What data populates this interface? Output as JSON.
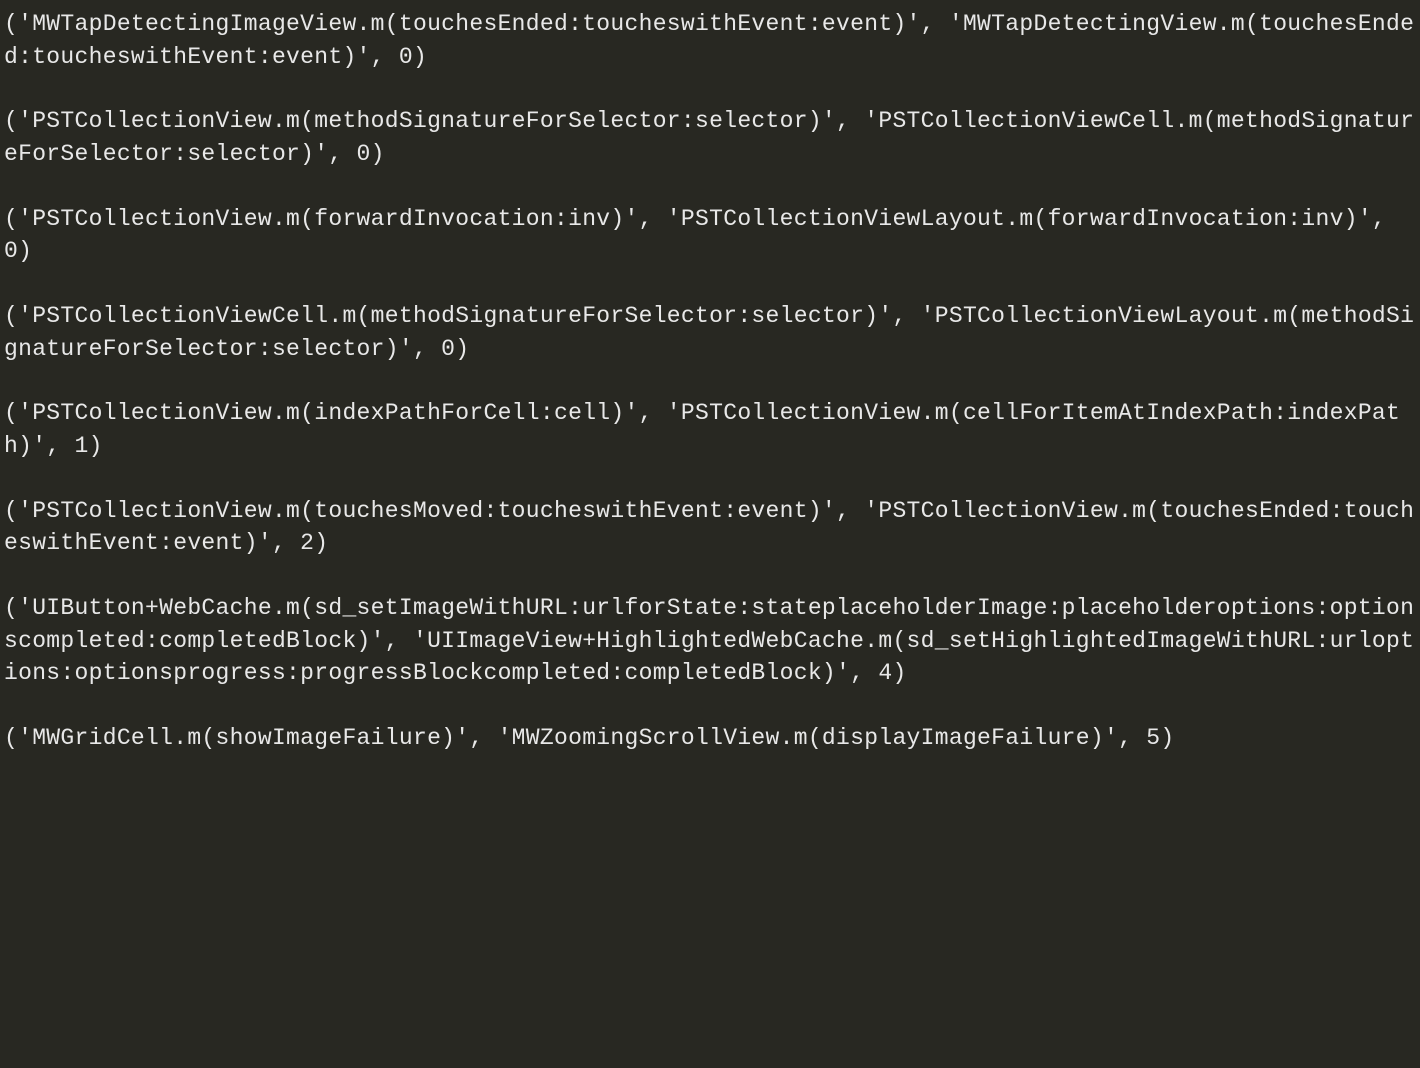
{
  "tuples": [
    "('MWTapDetectingImageView.m(touchesEnded:toucheswithEvent:event)', 'MWTapDetectingView.m(touchesEnded:toucheswithEvent:event)', 0)",
    "('PSTCollectionView.m(methodSignatureForSelector:selector)', 'PSTCollectionViewCell.m(methodSignatureForSelector:selector)', 0)",
    "('PSTCollectionView.m(forwardInvocation:inv)', 'PSTCollectionViewLayout.m(forwardInvocation:inv)', 0)",
    "('PSTCollectionViewCell.m(methodSignatureForSelector:selector)', 'PSTCollectionViewLayout.m(methodSignatureForSelector:selector)', 0)",
    "('PSTCollectionView.m(indexPathForCell:cell)', 'PSTCollectionView.m(cellForItemAtIndexPath:indexPath)', 1)",
    "('PSTCollectionView.m(touchesMoved:toucheswithEvent:event)', 'PSTCollectionView.m(touchesEnded:toucheswithEvent:event)', 2)",
    "('UIButton+WebCache.m(sd_setImageWithURL:urlforState:stateplaceholderImage:placeholderoptions:optionscompleted:completedBlock)', 'UIImageView+HighlightedWebCache.m(sd_setHighlightedImageWithURL:urloptions:optionsprogress:progressBlockcompleted:completedBlock)', 4)",
    "('MWGridCell.m(showImageFailure)', 'MWZoomingScrollView.m(displayImageFailure)', 5)"
  ]
}
